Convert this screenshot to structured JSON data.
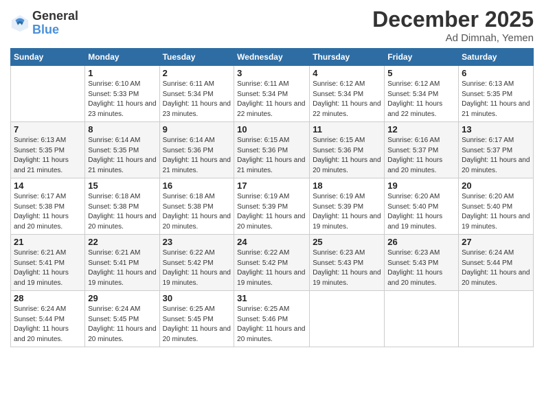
{
  "logo": {
    "general": "General",
    "blue": "Blue"
  },
  "title": "December 2025",
  "location": "Ad Dimnah, Yemen",
  "headers": [
    "Sunday",
    "Monday",
    "Tuesday",
    "Wednesday",
    "Thursday",
    "Friday",
    "Saturday"
  ],
  "weeks": [
    [
      {
        "day": "",
        "sunrise": "",
        "sunset": "",
        "daylight": ""
      },
      {
        "day": "1",
        "sunrise": "Sunrise: 6:10 AM",
        "sunset": "Sunset: 5:33 PM",
        "daylight": "Daylight: 11 hours and 23 minutes."
      },
      {
        "day": "2",
        "sunrise": "Sunrise: 6:11 AM",
        "sunset": "Sunset: 5:34 PM",
        "daylight": "Daylight: 11 hours and 23 minutes."
      },
      {
        "day": "3",
        "sunrise": "Sunrise: 6:11 AM",
        "sunset": "Sunset: 5:34 PM",
        "daylight": "Daylight: 11 hours and 22 minutes."
      },
      {
        "day": "4",
        "sunrise": "Sunrise: 6:12 AM",
        "sunset": "Sunset: 5:34 PM",
        "daylight": "Daylight: 11 hours and 22 minutes."
      },
      {
        "day": "5",
        "sunrise": "Sunrise: 6:12 AM",
        "sunset": "Sunset: 5:34 PM",
        "daylight": "Daylight: 11 hours and 22 minutes."
      },
      {
        "day": "6",
        "sunrise": "Sunrise: 6:13 AM",
        "sunset": "Sunset: 5:35 PM",
        "daylight": "Daylight: 11 hours and 21 minutes."
      }
    ],
    [
      {
        "day": "7",
        "sunrise": "Sunrise: 6:13 AM",
        "sunset": "Sunset: 5:35 PM",
        "daylight": "Daylight: 11 hours and 21 minutes."
      },
      {
        "day": "8",
        "sunrise": "Sunrise: 6:14 AM",
        "sunset": "Sunset: 5:35 PM",
        "daylight": "Daylight: 11 hours and 21 minutes."
      },
      {
        "day": "9",
        "sunrise": "Sunrise: 6:14 AM",
        "sunset": "Sunset: 5:36 PM",
        "daylight": "Daylight: 11 hours and 21 minutes."
      },
      {
        "day": "10",
        "sunrise": "Sunrise: 6:15 AM",
        "sunset": "Sunset: 5:36 PM",
        "daylight": "Daylight: 11 hours and 21 minutes."
      },
      {
        "day": "11",
        "sunrise": "Sunrise: 6:15 AM",
        "sunset": "Sunset: 5:36 PM",
        "daylight": "Daylight: 11 hours and 20 minutes."
      },
      {
        "day": "12",
        "sunrise": "Sunrise: 6:16 AM",
        "sunset": "Sunset: 5:37 PM",
        "daylight": "Daylight: 11 hours and 20 minutes."
      },
      {
        "day": "13",
        "sunrise": "Sunrise: 6:17 AM",
        "sunset": "Sunset: 5:37 PM",
        "daylight": "Daylight: 11 hours and 20 minutes."
      }
    ],
    [
      {
        "day": "14",
        "sunrise": "Sunrise: 6:17 AM",
        "sunset": "Sunset: 5:38 PM",
        "daylight": "Daylight: 11 hours and 20 minutes."
      },
      {
        "day": "15",
        "sunrise": "Sunrise: 6:18 AM",
        "sunset": "Sunset: 5:38 PM",
        "daylight": "Daylight: 11 hours and 20 minutes."
      },
      {
        "day": "16",
        "sunrise": "Sunrise: 6:18 AM",
        "sunset": "Sunset: 5:38 PM",
        "daylight": "Daylight: 11 hours and 20 minutes."
      },
      {
        "day": "17",
        "sunrise": "Sunrise: 6:19 AM",
        "sunset": "Sunset: 5:39 PM",
        "daylight": "Daylight: 11 hours and 20 minutes."
      },
      {
        "day": "18",
        "sunrise": "Sunrise: 6:19 AM",
        "sunset": "Sunset: 5:39 PM",
        "daylight": "Daylight: 11 hours and 19 minutes."
      },
      {
        "day": "19",
        "sunrise": "Sunrise: 6:20 AM",
        "sunset": "Sunset: 5:40 PM",
        "daylight": "Daylight: 11 hours and 19 minutes."
      },
      {
        "day": "20",
        "sunrise": "Sunrise: 6:20 AM",
        "sunset": "Sunset: 5:40 PM",
        "daylight": "Daylight: 11 hours and 19 minutes."
      }
    ],
    [
      {
        "day": "21",
        "sunrise": "Sunrise: 6:21 AM",
        "sunset": "Sunset: 5:41 PM",
        "daylight": "Daylight: 11 hours and 19 minutes."
      },
      {
        "day": "22",
        "sunrise": "Sunrise: 6:21 AM",
        "sunset": "Sunset: 5:41 PM",
        "daylight": "Daylight: 11 hours and 19 minutes."
      },
      {
        "day": "23",
        "sunrise": "Sunrise: 6:22 AM",
        "sunset": "Sunset: 5:42 PM",
        "daylight": "Daylight: 11 hours and 19 minutes."
      },
      {
        "day": "24",
        "sunrise": "Sunrise: 6:22 AM",
        "sunset": "Sunset: 5:42 PM",
        "daylight": "Daylight: 11 hours and 19 minutes."
      },
      {
        "day": "25",
        "sunrise": "Sunrise: 6:23 AM",
        "sunset": "Sunset: 5:43 PM",
        "daylight": "Daylight: 11 hours and 19 minutes."
      },
      {
        "day": "26",
        "sunrise": "Sunrise: 6:23 AM",
        "sunset": "Sunset: 5:43 PM",
        "daylight": "Daylight: 11 hours and 20 minutes."
      },
      {
        "day": "27",
        "sunrise": "Sunrise: 6:24 AM",
        "sunset": "Sunset: 5:44 PM",
        "daylight": "Daylight: 11 hours and 20 minutes."
      }
    ],
    [
      {
        "day": "28",
        "sunrise": "Sunrise: 6:24 AM",
        "sunset": "Sunset: 5:44 PM",
        "daylight": "Daylight: 11 hours and 20 minutes."
      },
      {
        "day": "29",
        "sunrise": "Sunrise: 6:24 AM",
        "sunset": "Sunset: 5:45 PM",
        "daylight": "Daylight: 11 hours and 20 minutes."
      },
      {
        "day": "30",
        "sunrise": "Sunrise: 6:25 AM",
        "sunset": "Sunset: 5:45 PM",
        "daylight": "Daylight: 11 hours and 20 minutes."
      },
      {
        "day": "31",
        "sunrise": "Sunrise: 6:25 AM",
        "sunset": "Sunset: 5:46 PM",
        "daylight": "Daylight: 11 hours and 20 minutes."
      },
      {
        "day": "",
        "sunrise": "",
        "sunset": "",
        "daylight": ""
      },
      {
        "day": "",
        "sunrise": "",
        "sunset": "",
        "daylight": ""
      },
      {
        "day": "",
        "sunrise": "",
        "sunset": "",
        "daylight": ""
      }
    ]
  ]
}
